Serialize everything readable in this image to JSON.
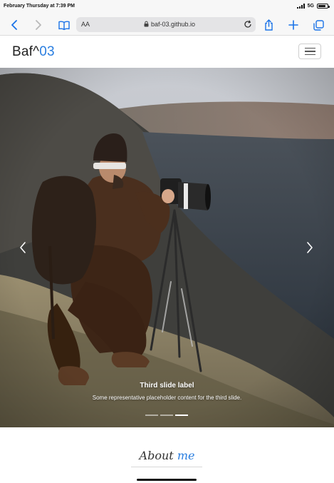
{
  "status_bar": {
    "time": "February Thursday at 7:39 PM",
    "network": "5G"
  },
  "browser": {
    "text_size_label": "AA",
    "url": "baf-03.github.io",
    "accent_color": "#1a73e8"
  },
  "site": {
    "brand_main": "Baf^",
    "brand_accent": "03",
    "accent_color": "#2a7ee0"
  },
  "carousel": {
    "caption_title": "Third slide label",
    "caption_text": "Some representative placeholder content for the third slide.",
    "slide_count": 3,
    "active_slide": 3
  },
  "about": {
    "title_main": "About",
    "title_accent": "me"
  }
}
